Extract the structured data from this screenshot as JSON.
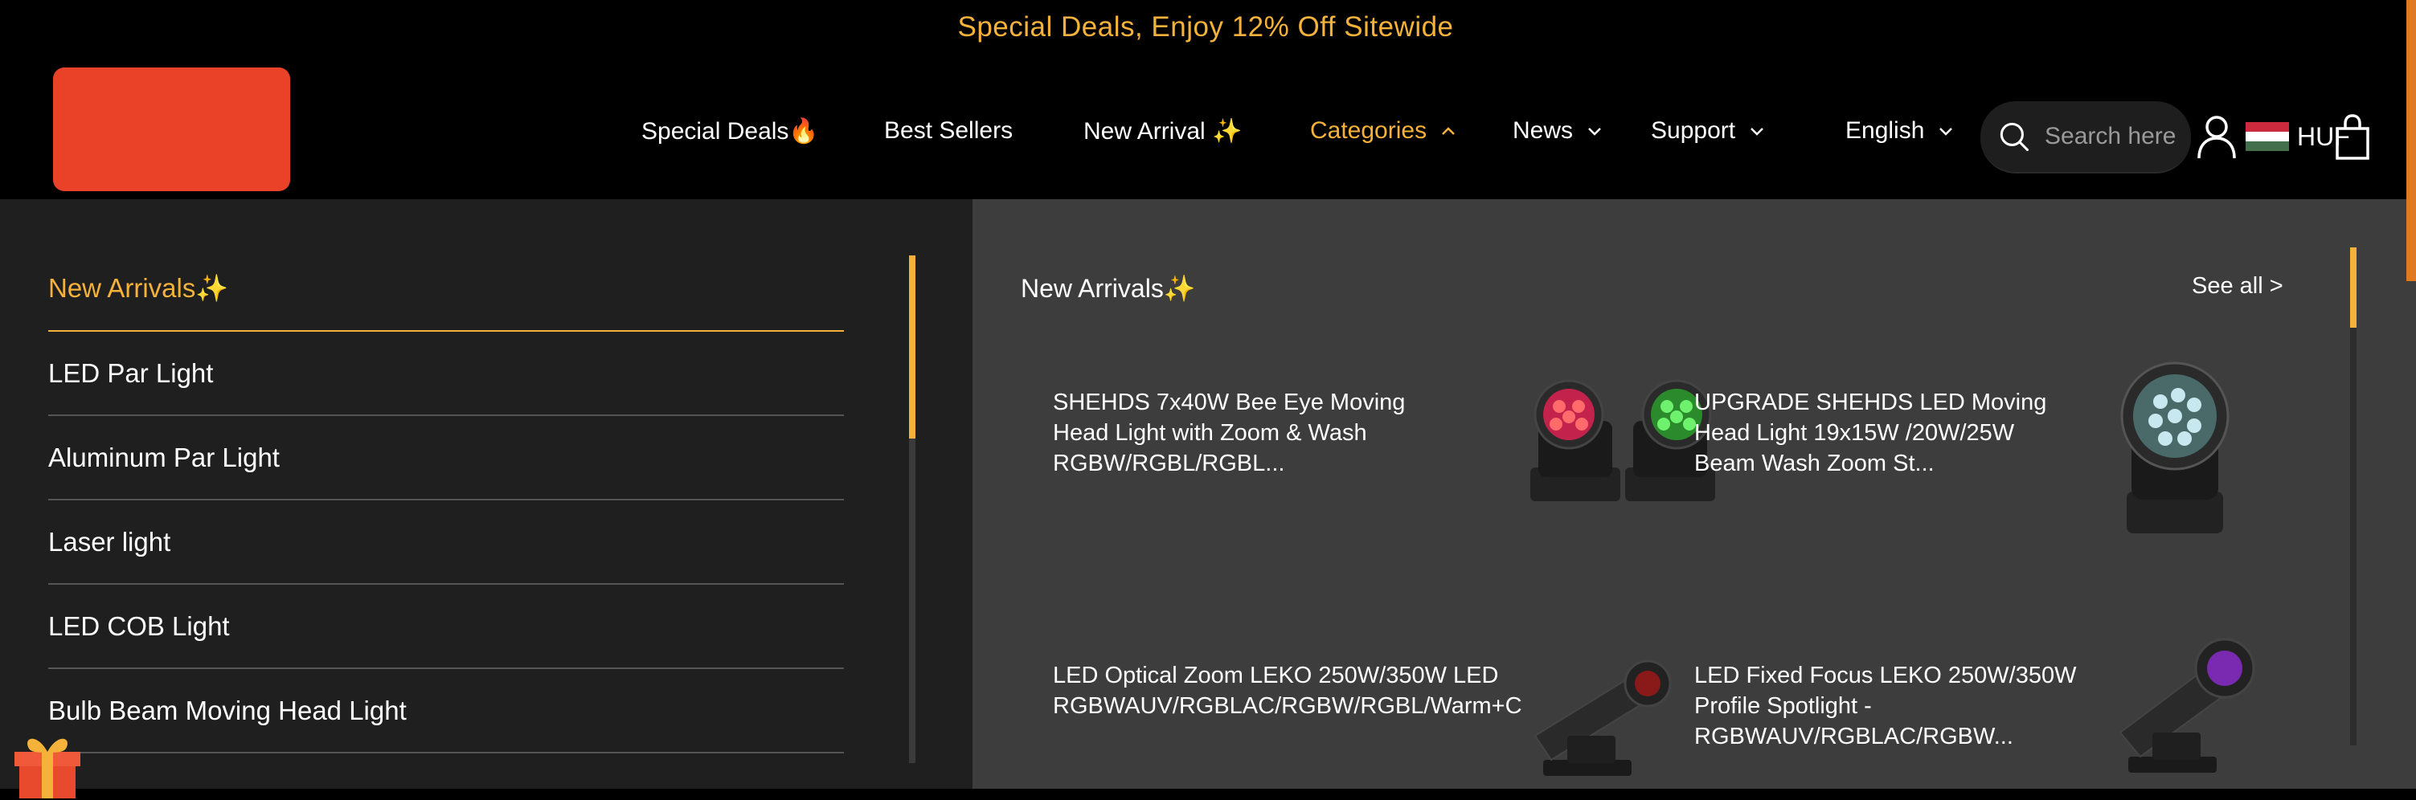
{
  "announcement": "Special Deals, Enjoy 12% Off Sitewide",
  "nav": {
    "special_deals": "Special Deals🔥",
    "best_sellers": "Best Sellers",
    "new_arrival": "New Arrival ✨",
    "categories": "Categories",
    "news": "News",
    "support": "Support",
    "language": "English"
  },
  "search": {
    "placeholder": "Search here"
  },
  "currency": "HUF",
  "categories": [
    {
      "label": "New Arrivals✨"
    },
    {
      "label": "LED Par Light"
    },
    {
      "label": "Aluminum Par Light"
    },
    {
      "label": "Laser light"
    },
    {
      "label": "LED COB Light"
    },
    {
      "label": "Bulb Beam Moving Head Light"
    }
  ],
  "panel": {
    "title": "New Arrivals✨",
    "see_all": "See all >",
    "products": [
      {
        "name": "SHEHDS 7x40W Bee Eye Moving Head Light with Zoom & Wash RGBW/RGBL/RGBL..."
      },
      {
        "name": "UPGRADE SHEHDS LED Moving Head Light 19x15W /20W/25W Beam Wash Zoom St..."
      },
      {
        "name": "LED Optical Zoom LEKO 250W/350W LED RGBWAUV/RGBLAC/RGBW/RGBL/Warm+C"
      },
      {
        "name": "LED Fixed Focus LEKO 250W/350W Profile Spotlight - RGBWAUV/RGBLAC/RGBW..."
      }
    ]
  },
  "colors": {
    "accent": "#f5b23a",
    "logo": "#ea4229",
    "background": "#000000",
    "left_panel": "#1f1f1f",
    "right_panel": "#3d3d3d"
  }
}
